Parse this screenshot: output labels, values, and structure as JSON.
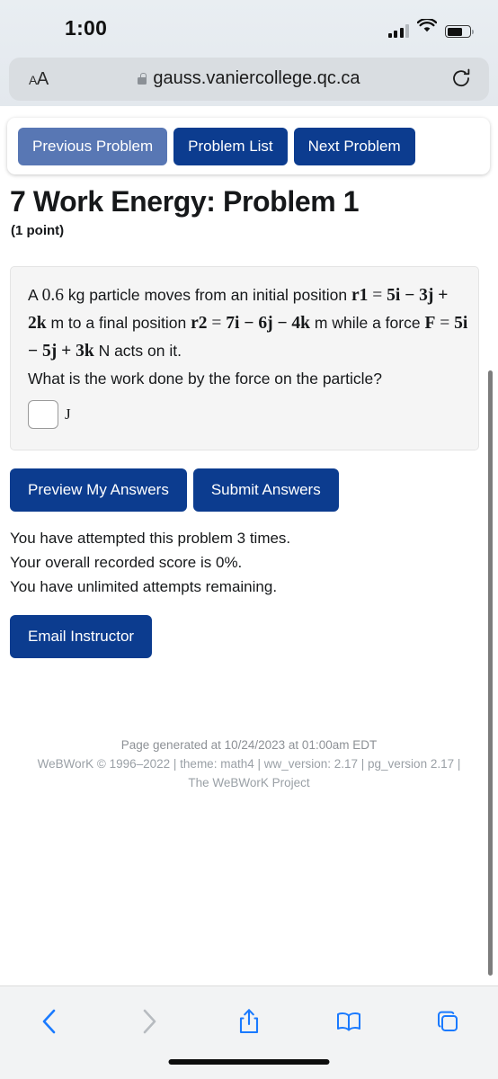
{
  "status_bar": {
    "time": "1:00",
    "signal_icon": "cellular-signal-icon",
    "wifi_icon": "wifi-icon",
    "battery_icon": "battery-icon"
  },
  "browser": {
    "text_size_label": "AA",
    "lock_icon": "lock-icon",
    "url": "gauss.vaniercollege.qc.ca",
    "reload_icon": "reload-icon",
    "toolbar": {
      "back_icon": "back-chevron-icon",
      "forward_icon": "forward-chevron-icon",
      "share_icon": "share-icon",
      "bookmarks_icon": "book-icon",
      "tabs_icon": "tabs-icon"
    }
  },
  "nav": {
    "previous": "Previous Problem",
    "problem_list": "Problem List",
    "next": "Next Problem"
  },
  "problem": {
    "title": "7 Work Energy: Problem 1",
    "points": "(1 point)",
    "text": {
      "l1_a": "A",
      "l1_mass": "0.6",
      "l1_b": "kg particle moves from an initial position",
      "l2_r1": "r1",
      "l2_eq": "=",
      "l2_vec1": "5i − 3j + 2k",
      "l2_mid": "m to a final position",
      "l2_r2": "r2",
      "l2_eq2": "=",
      "l2_vec2": "7i − 6j − 4k",
      "l3_a": "m while a force",
      "l3_F": "F",
      "l3_eq": "=",
      "l3_vec": "5i − 5j + 3k",
      "l3_b": "N acts on it.",
      "l4": "What is the work done by the force on the particle?"
    },
    "answer_value": "",
    "answer_placeholder": "",
    "answer_unit": "J"
  },
  "actions": {
    "preview": "Preview My Answers",
    "submit": "Submit Answers",
    "email": "Email Instructor"
  },
  "status": {
    "attempts": "You have attempted this problem 3 times.",
    "score": "Your overall recorded score is 0%.",
    "remaining": "You have unlimited attempts remaining."
  },
  "footer": {
    "line1": "Page generated at 10/24/2023 at 01:00am EDT",
    "line2": "WeBWorK © 1996–2022 | theme: math4 | ww_version: 2.17 | pg_version 2.17 |",
    "line3": "The WeBWorK Project"
  },
  "colors": {
    "button_primary": "#0c3c8f",
    "button_muted": "#5877b4",
    "panel_bg": "#f5f5f5",
    "ios_blue": "#1a7aff"
  }
}
